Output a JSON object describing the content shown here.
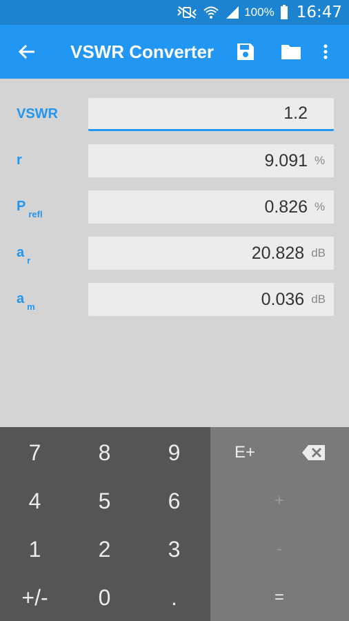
{
  "status_bar": {
    "battery_text": "100%",
    "time": "16:47",
    "icons": [
      "mute-vibrate-icon",
      "wifi-icon",
      "cell-signal-icon",
      "battery-icon"
    ]
  },
  "app_bar": {
    "title": "VSWR Converter",
    "icons": [
      "back-arrow-icon",
      "save-icon",
      "folder-icon",
      "more-vert-icon"
    ],
    "color": "#2196f3"
  },
  "fields": [
    {
      "label": "VSWR",
      "sub": "",
      "value": "1.2",
      "unit": ""
    },
    {
      "label": "r",
      "sub": "",
      "value": "9.091",
      "unit": "%"
    },
    {
      "label": "P",
      "sub": "refl",
      "value": "0.826",
      "unit": "%"
    },
    {
      "label": "a",
      "sub": "r",
      "value": "20.828",
      "unit": "dB"
    },
    {
      "label": "a",
      "sub": "m",
      "value": "0.036",
      "unit": "dB"
    }
  ],
  "keypad": {
    "numeric": [
      "7",
      "8",
      "9",
      "4",
      "5",
      "6",
      "1",
      "2",
      "3",
      "+/-",
      "0",
      "."
    ],
    "ops": {
      "exp": "E+",
      "plus": "+",
      "minus": "-",
      "equals": "="
    }
  }
}
